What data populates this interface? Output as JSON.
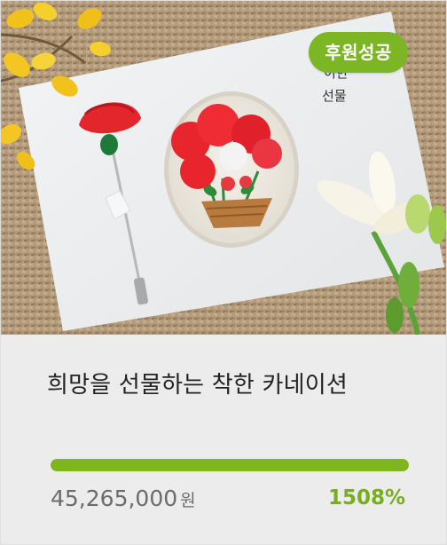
{
  "project": {
    "badge": "후원성공",
    "title": "희망을 선물하는 착한 카네이션",
    "amount": "45,265,000",
    "currency": "원",
    "percent_label": "1508%",
    "progress_fraction": 1.0
  },
  "photo": {
    "card_text_line1": "이한",
    "card_text_line2": "선물",
    "icon": "embroidered-carnation-brooch-photo"
  },
  "colors": {
    "accent": "#7db625",
    "progress_fill": "#7fb61f",
    "percent_text": "#78ad1c",
    "panel_bg": "#ececec"
  }
}
